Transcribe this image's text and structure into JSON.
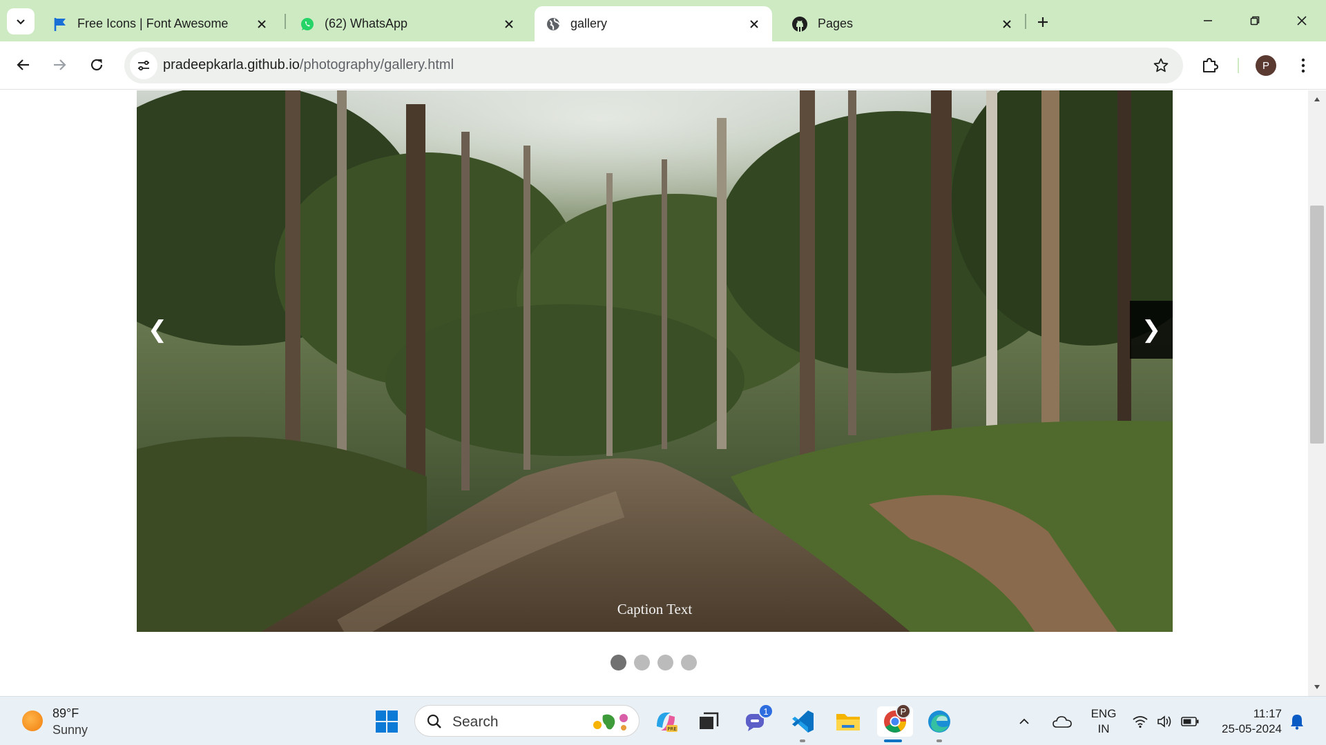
{
  "browser": {
    "tabs": [
      {
        "title": "Free Icons | Font Awesome",
        "icon": "font-awesome-flag-icon",
        "active": false
      },
      {
        "title": "(62) WhatsApp",
        "icon": "whatsapp-icon",
        "active": false
      },
      {
        "title": "gallery",
        "icon": "globe-icon",
        "active": true
      },
      {
        "title": "Pages",
        "icon": "github-icon",
        "active": false
      }
    ],
    "url_host": "pradeepkarla.github.io",
    "url_path": "/photography/gallery.html",
    "profile_initial": "P"
  },
  "gallery": {
    "caption": "Caption Text",
    "prev_symbol": "❮",
    "next_symbol": "❯",
    "slide_count": 4,
    "active_slide": 1
  },
  "taskbar": {
    "weather_temp": "89°F",
    "weather_desc": "Sunny",
    "search_label": "Search",
    "teams_badge": "1",
    "chrome_badge": "P",
    "lang_top": "ENG",
    "lang_bottom": "IN",
    "time": "11:17",
    "date": "25-05-2024"
  },
  "colors": {
    "tabstrip": "#cdeac3",
    "accent_blue": "#0078d4",
    "next_button_bg": "#000000"
  }
}
